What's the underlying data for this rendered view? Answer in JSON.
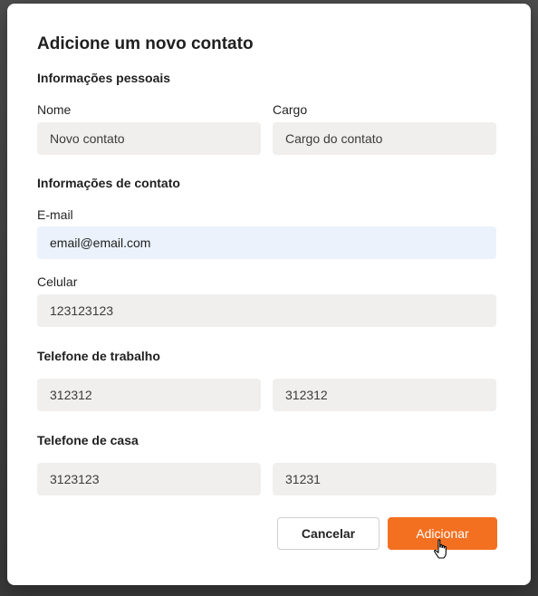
{
  "dialog": {
    "title": "Adicione um novo contato"
  },
  "personal": {
    "heading": "Informações pessoais",
    "name_label": "Nome",
    "name_value": "Novo contato",
    "role_label": "Cargo",
    "role_value": "Cargo do contato"
  },
  "contact": {
    "heading": "Informações de contato",
    "email_label": "E-mail",
    "email_value": "email@email.com",
    "mobile_label": "Celular",
    "mobile_value": "123123123"
  },
  "work_phone": {
    "heading": "Telefone de trabalho",
    "value_1": "312312",
    "value_2": "312312"
  },
  "home_phone": {
    "heading": "Telefone de casa",
    "value_1": "3123123",
    "value_2": "31231"
  },
  "actions": {
    "cancel_label": "Cancelar",
    "add_label": "Adicionar"
  },
  "colors": {
    "accent": "#f47021",
    "field_bg": "#f0efed",
    "field_focused_bg": "#ebf2fc"
  },
  "icons": {
    "cursor": "hand-pointer-icon"
  }
}
